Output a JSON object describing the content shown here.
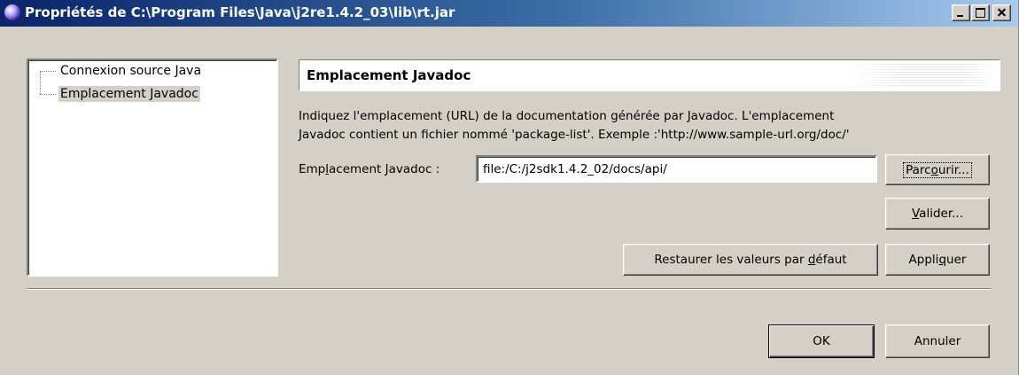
{
  "window": {
    "title": "Propriétés de C:\\Program Files\\Java\\j2re1.4.2_03\\lib\\rt.jar",
    "icon": "eclipse-icon"
  },
  "tree": {
    "items": [
      {
        "label": "Connexion source Java",
        "selected": false
      },
      {
        "label": "Emplacement Javadoc",
        "selected": true
      }
    ]
  },
  "page": {
    "title": "Emplacement Javadoc",
    "description_line1": "Indiquez l'emplacement (URL) de la documentation générée par Javadoc. L'emplacement",
    "description_line2": "Javadoc contient un fichier nommé 'package-list'. Exemple :'http://www.sample-url.org/doc/'",
    "location_label": "Emplacement Javadoc :",
    "location_value": "file:/C:/j2sdk1.4.2_02/docs/api/"
  },
  "buttons": {
    "browse": "Parcourir...",
    "validate": "Valider...",
    "restore_defaults": "Restaurer les valeurs par défaut",
    "apply": "Appliquer",
    "ok": "OK",
    "cancel": "Annuler"
  }
}
